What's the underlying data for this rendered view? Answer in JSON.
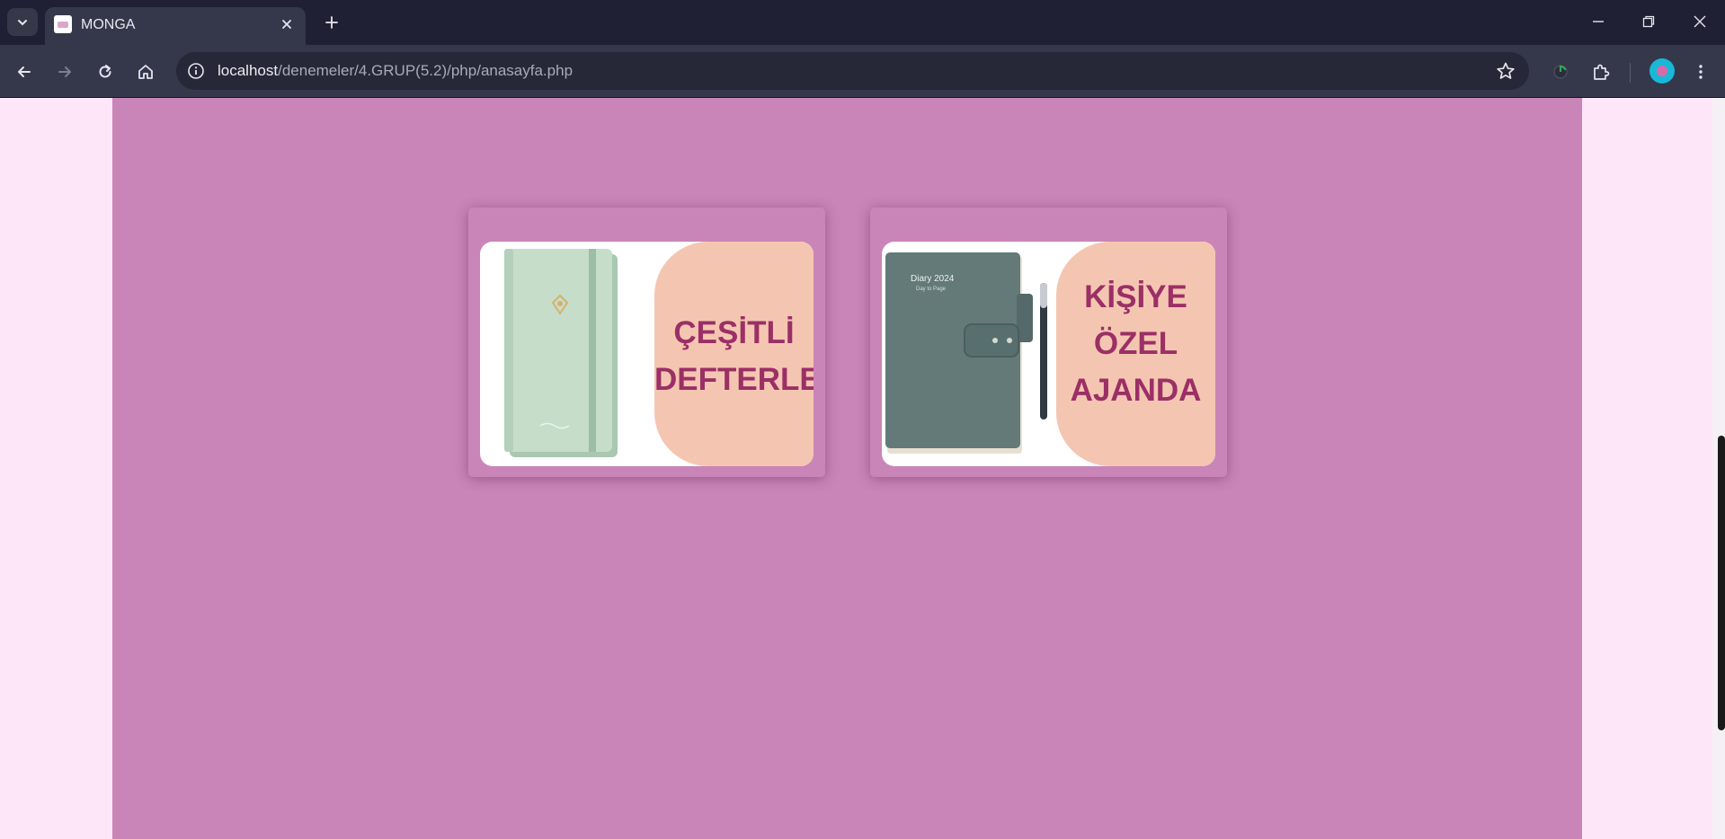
{
  "browser": {
    "tab_title": "MONGA",
    "url_host": "localhost",
    "url_path": "/denemeler/4.GRUP(5.2)/php/anasayfa.php"
  },
  "cards": [
    {
      "line1": "ÇEŞİTLİ",
      "line2": "DEFTERLER",
      "line3": ""
    },
    {
      "line1": "KİŞİYE",
      "line2": "ÖZEL",
      "line3": "AJANDA",
      "cover_text": "Diary 2024",
      "cover_sub": "Day to Page"
    }
  ],
  "colors": {
    "chrome_dark": "#1f2033",
    "content_bg": "#c985b8",
    "page_bg": "#fde6f8",
    "panel_peach": "#f4c6b1",
    "title_text": "#9b2f66"
  }
}
